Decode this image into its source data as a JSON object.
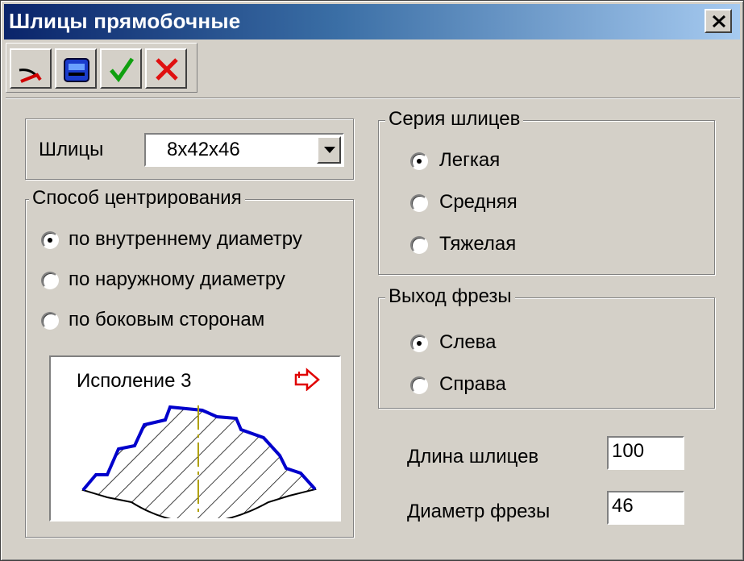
{
  "window": {
    "title": "Шлицы прямобочные"
  },
  "toolbar": {
    "buttons": [
      {
        "icon": "pen-curve-icon"
      },
      {
        "icon": "save-icon"
      },
      {
        "icon": "checkmark-icon"
      },
      {
        "icon": "cancel-x-icon"
      }
    ]
  },
  "splines": {
    "label": "Шлицы",
    "selected": "8x42x46"
  },
  "centering": {
    "legend": "Способ центрирования",
    "options": [
      "по внутреннему диаметру",
      "по наружному диаметру",
      "по боковым сторонам"
    ],
    "selected_index": 0
  },
  "preview": {
    "caption": "Исполение 3"
  },
  "series": {
    "legend": "Серия шлицев",
    "options": [
      "Легкая",
      "Средняя",
      "Тяжелая"
    ],
    "selected_index": 0
  },
  "cutter_exit": {
    "legend": "Выход фрезы",
    "options": [
      "Слева",
      "Справа"
    ],
    "selected_index": 0
  },
  "fields": {
    "length_label": "Длина шлицев",
    "length_value": "100",
    "diameter_label": "Диаметр фрезы",
    "diameter_value": "46"
  },
  "colors": {
    "title_start": "#0a246a",
    "title_end": "#a6caf0",
    "face": "#d4d0c8",
    "profile": "#0000cc",
    "axis": "#b0a000",
    "arrow": "#e00000"
  }
}
